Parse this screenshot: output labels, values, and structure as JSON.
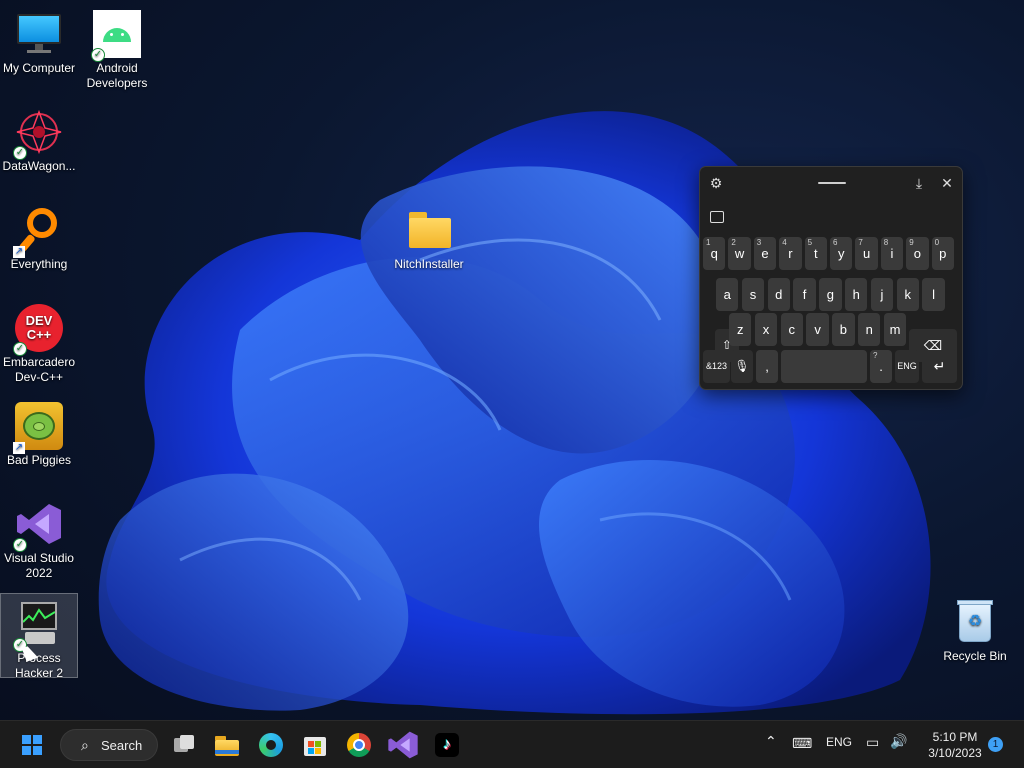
{
  "desktop": {
    "icons": [
      {
        "label": "My Computer"
      },
      {
        "label": "Android\nDevelopers"
      },
      {
        "label": "DataWagon..."
      },
      {
        "label": "Everything"
      },
      {
        "label": "Embarcadero\nDev-C++"
      },
      {
        "label": "Bad Piggies"
      },
      {
        "label": "Visual Studio\n2022"
      },
      {
        "label": "Process\nHacker 2"
      },
      {
        "label": "NitchInstaller"
      },
      {
        "label": "Recycle Bin"
      }
    ],
    "devcpp_text": "DEV\nC++"
  },
  "keyboard": {
    "row1": [
      {
        "k": "q",
        "n": "1"
      },
      {
        "k": "w",
        "n": "2"
      },
      {
        "k": "e",
        "n": "3"
      },
      {
        "k": "r",
        "n": "4"
      },
      {
        "k": "t",
        "n": "5"
      },
      {
        "k": "y",
        "n": "6"
      },
      {
        "k": "u",
        "n": "7"
      },
      {
        "k": "i",
        "n": "8"
      },
      {
        "k": "o",
        "n": "9"
      },
      {
        "k": "p",
        "n": "0"
      }
    ],
    "row2": [
      "a",
      "s",
      "d",
      "f",
      "g",
      "h",
      "j",
      "k",
      "l"
    ],
    "row3": [
      "z",
      "x",
      "c",
      "v",
      "b",
      "n",
      "m"
    ],
    "sym_key": "&123",
    "comma_key": ",",
    "period_key": ".",
    "period_sup": "?",
    "lang_key": "ENG"
  },
  "taskbar": {
    "search_label": "Search",
    "tray_lang": "ENG",
    "time": "5:10 PM",
    "date": "3/10/2023",
    "notifications": "1"
  },
  "colors": {
    "accent": "#1e56ff",
    "taskbar": "#1c1c1c",
    "keyboard_bg": "#202020"
  }
}
